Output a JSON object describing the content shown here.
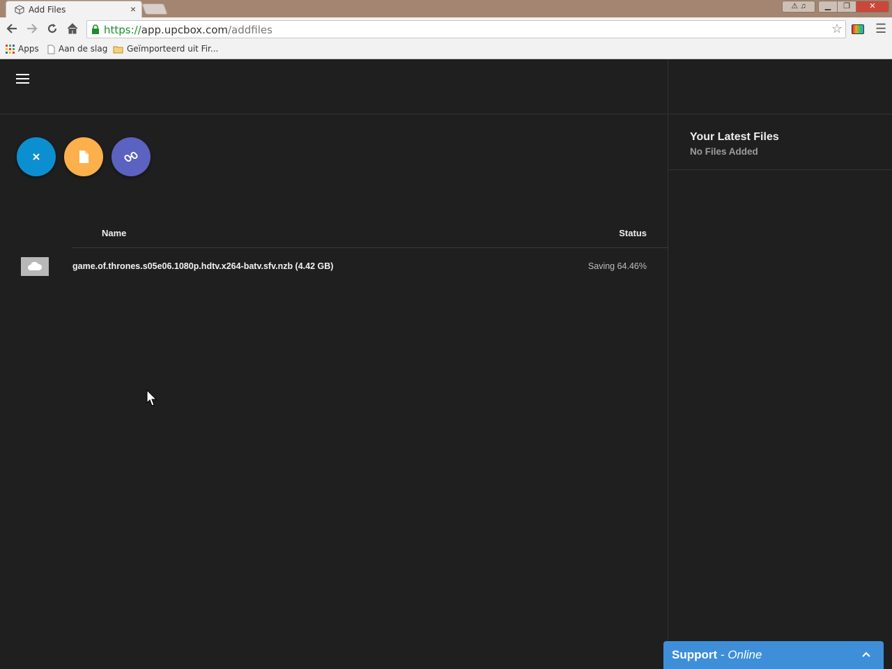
{
  "browser": {
    "tab_title": "Add Files",
    "tab_close": "×",
    "url_scheme": "https://",
    "url_host": "app.upcbox.com",
    "url_path": "/addfiles",
    "bookmarks": [
      {
        "label": "Apps",
        "icon": "apps-grid-icon"
      },
      {
        "label": "Aan de slag",
        "icon": "page-icon"
      },
      {
        "label": "Geïmporteerd uit Fir...",
        "icon": "folder-icon"
      }
    ]
  },
  "actions": {
    "buttons": [
      {
        "name": "close",
        "color": "#0b8fd1",
        "icon": "close-icon"
      },
      {
        "name": "file",
        "color": "#fbb04b",
        "icon": "file-icon"
      },
      {
        "name": "link",
        "color": "#5b62bf",
        "icon": "link-icon"
      }
    ]
  },
  "table": {
    "headers": {
      "name": "Name",
      "status": "Status"
    },
    "rows": [
      {
        "name": "game.of.thrones.s05e06.1080p.hdtv.x264-batv.sfv.nzb (4.42 GB)",
        "status": "Saving 64.46%",
        "icon": "cloud-icon"
      }
    ]
  },
  "sidebar": {
    "title": "Your Latest Files",
    "subtitle": "No Files Added"
  },
  "support": {
    "label": "Support",
    "separator": " - ",
    "status": "Online",
    "color": "#3e8fd8"
  }
}
